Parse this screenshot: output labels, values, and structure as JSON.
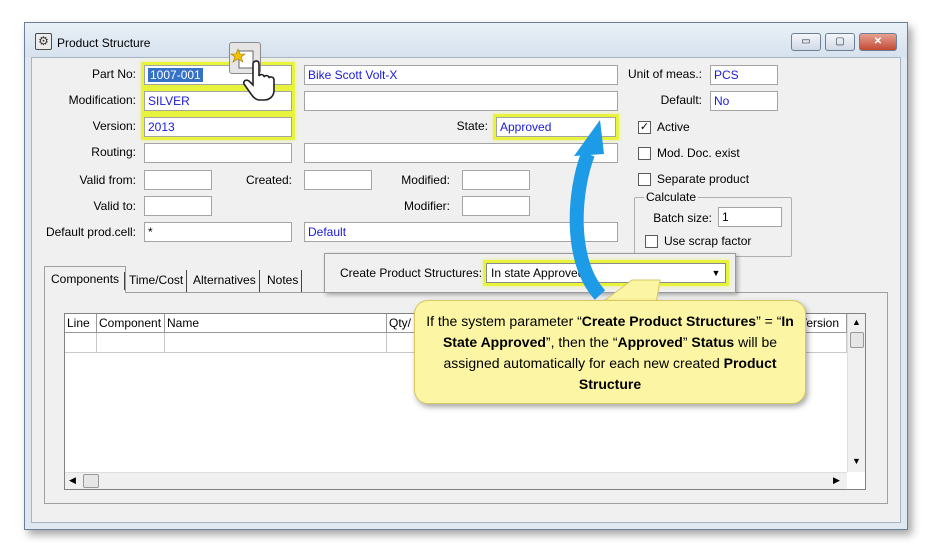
{
  "window": {
    "title": "Product Structure",
    "minimize": "▭",
    "maximize": "▢",
    "close": "✕"
  },
  "form": {
    "part_no": {
      "label": "Part No:",
      "value": "1007-001",
      "description": "Bike Scott Volt-X"
    },
    "modification": {
      "label": "Modification:",
      "value": "SILVER"
    },
    "version": {
      "label": "Version:",
      "value": "2013"
    },
    "state": {
      "label": "State:",
      "value": "Approved"
    },
    "routing": {
      "label": "Routing:"
    },
    "valid_from": {
      "label": "Valid from:"
    },
    "created": {
      "label": "Created:"
    },
    "modified": {
      "label": "Modified:"
    },
    "valid_to": {
      "label": "Valid to:"
    },
    "modifier": {
      "label": "Modifier:"
    },
    "default_prod_cell": {
      "label": "Default prod.cell:",
      "value": "*",
      "description": "Default"
    },
    "unit_of_meas": {
      "label": "Unit of meas.:",
      "value": "PCS"
    },
    "default": {
      "label": "Default:",
      "value": "No"
    },
    "active": {
      "label": "Active",
      "checked": true
    },
    "mod_doc_exist": {
      "label": "Mod. Doc. exist",
      "checked": false
    },
    "separate_product": {
      "label": "Separate product",
      "checked": false
    },
    "calculate": {
      "title": "Calculate",
      "batch_size_label": "Batch size:",
      "batch_size_value": "1",
      "use_scrap_label": "Use scrap factor",
      "use_scrap_checked": false
    }
  },
  "tabs": [
    {
      "label": "Components"
    },
    {
      "label": "Time/Cost"
    },
    {
      "label": "Alternatives"
    },
    {
      "label": "Notes"
    }
  ],
  "grid": {
    "columns": [
      "Line",
      "Component",
      "Name",
      "Qty/",
      "Version"
    ]
  },
  "callout": {
    "create_label": "Create Product Structures:",
    "create_value": "In state Approved"
  },
  "note": {
    "p1": "If the system parameter “",
    "b1": "Create Product Structures",
    "p2": "” = “",
    "b2": "In State Approved",
    "p3": "”, then the “",
    "b3": "Approved",
    "p4": "” ",
    "b4": "Status",
    "p5": " will be assigned automatically for each new created ",
    "b5": "Product Structure"
  },
  "colors": {
    "highlight": "#e8f43c",
    "arrow": "#1d9be6",
    "note_bg": "#fcf6a4",
    "value_text": "#1a1adb"
  },
  "icons": {
    "app": "gear-icon",
    "cursor": "hand-pointer-icon",
    "new": "new-record-icon"
  }
}
